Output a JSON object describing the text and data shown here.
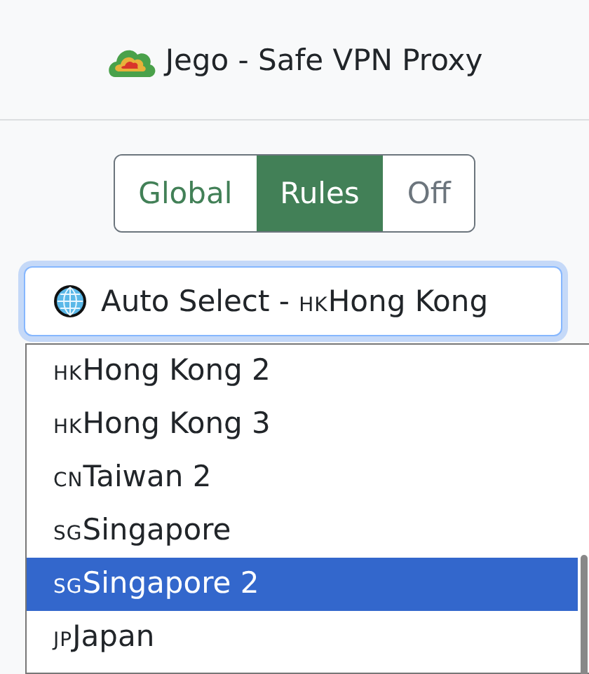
{
  "header": {
    "title": "Jego - Safe VPN Proxy"
  },
  "modes": [
    {
      "label": "Global",
      "selected": false
    },
    {
      "label": "Rules",
      "selected": true
    },
    {
      "label": "Off",
      "selected": false
    }
  ],
  "server_select": {
    "prefix": "Auto Select - ",
    "code": "HK",
    "name": "Hong Kong"
  },
  "dropdown": [
    {
      "code": "HK",
      "name": "Hong Kong 2",
      "selected": false
    },
    {
      "code": "HK",
      "name": "Hong Kong 3",
      "selected": false
    },
    {
      "code": "CN",
      "name": "Taiwan 2",
      "selected": false
    },
    {
      "code": "SG",
      "name": "Singapore",
      "selected": false
    },
    {
      "code": "SG",
      "name": "Singapore 2",
      "selected": true
    },
    {
      "code": "JP",
      "name": "Japan",
      "selected": false
    }
  ]
}
